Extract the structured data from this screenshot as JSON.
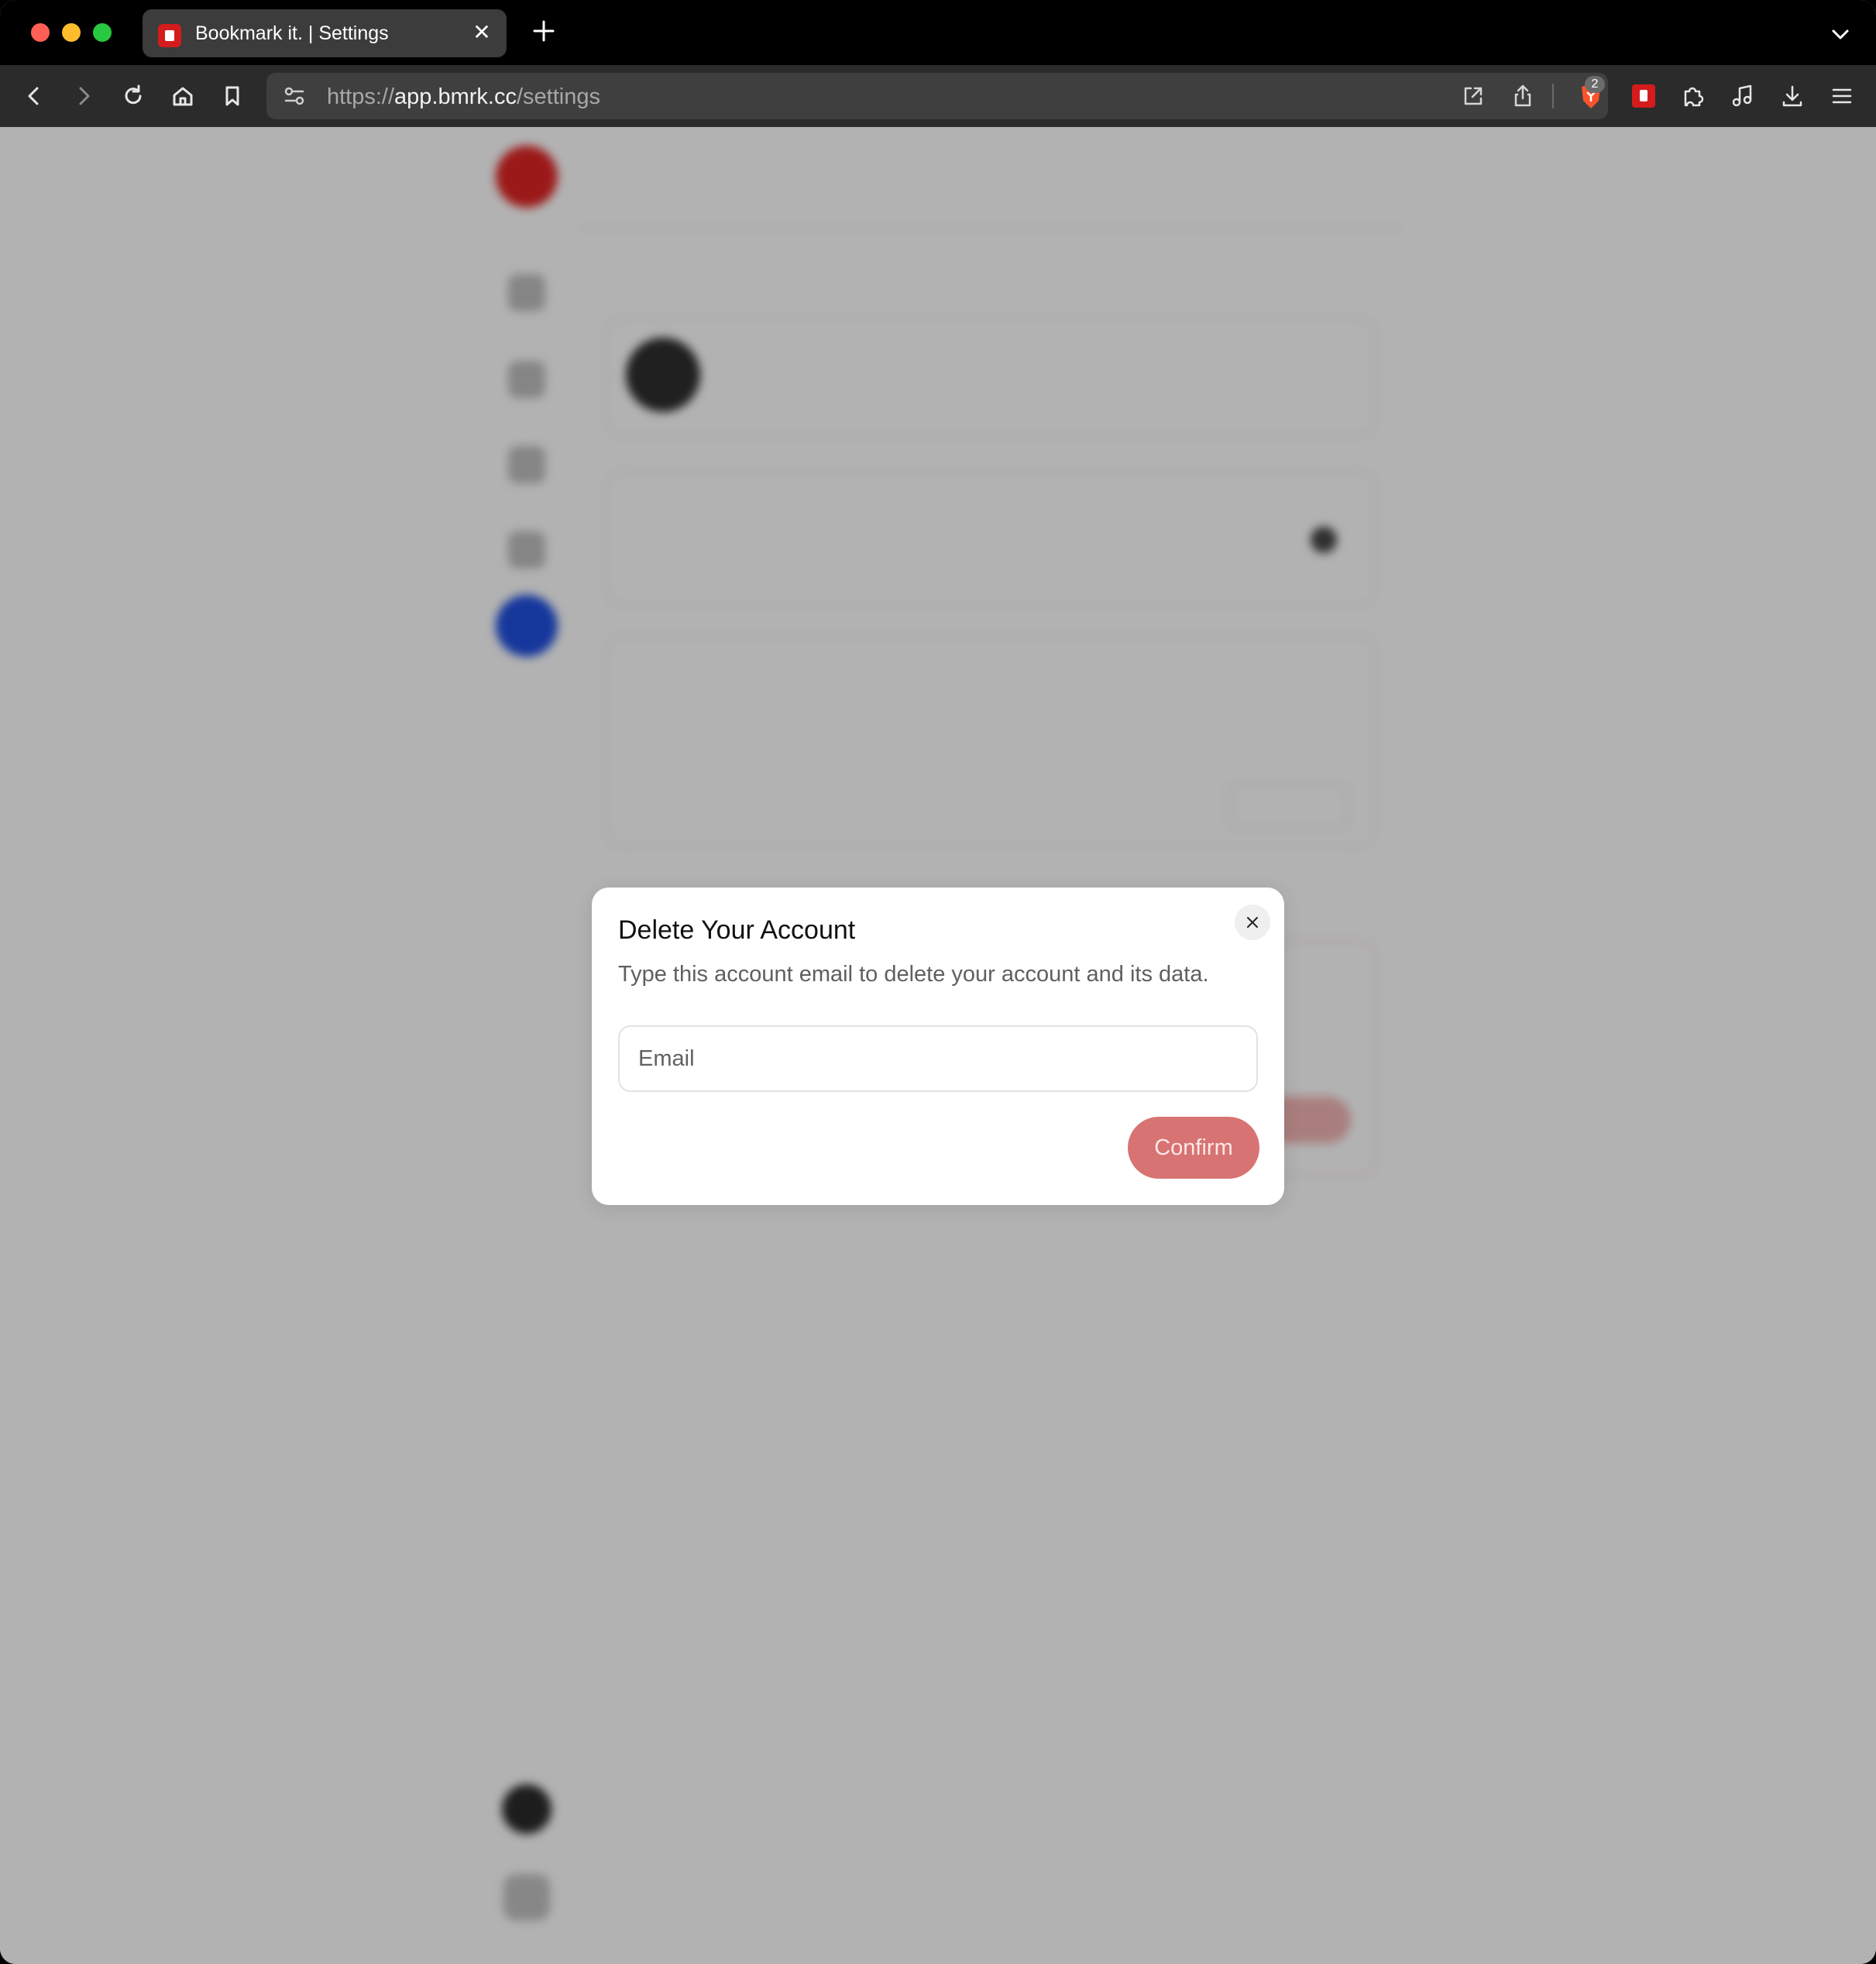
{
  "browser": {
    "tab": {
      "title": "Bookmark it. | Settings",
      "close_glyph": "✕"
    },
    "url": {
      "scheme": "https://",
      "host": "app.bmrk.cc",
      "path": "/settings"
    },
    "brave_shield_count": "2",
    "icons": [
      "back-icon",
      "forward-icon",
      "reload-icon",
      "home-icon",
      "bookmark-icon",
      "site-settings-icon",
      "open-external-icon",
      "share-icon",
      "brave-shield-icon",
      "bookmark-it-extension-icon",
      "extensions-icon",
      "media-icon",
      "download-icon",
      "menu-icon"
    ]
  },
  "colors": {
    "brand_red": "#e02424",
    "confirm_button": "#d87373",
    "add_button_blue": "#1f4fe0",
    "overlay": "rgba(0,0,0,0.30)"
  },
  "modal": {
    "title": "Delete Your Account",
    "description": "Type this account email to delete your account and its data.",
    "email_placeholder": "Email",
    "email_value": "",
    "confirm_label": "Confirm"
  }
}
